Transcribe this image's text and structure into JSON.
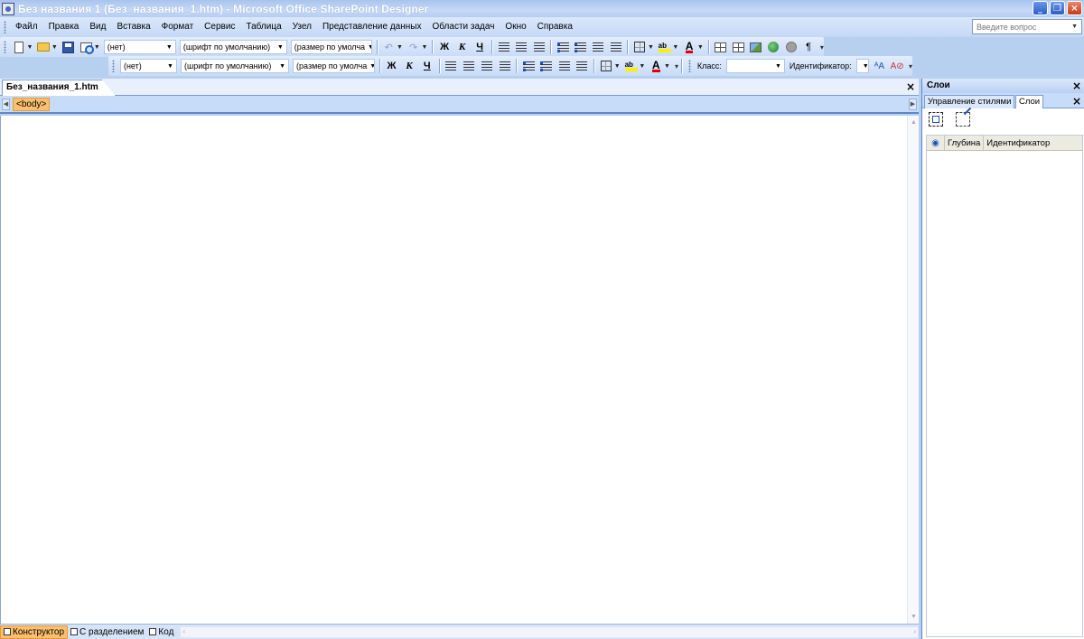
{
  "window": {
    "title": "Без названия 1 (Без_названия_1.htm) - Microsoft Office SharePoint Designer",
    "minimize": "_",
    "restore": "❐",
    "close": "×"
  },
  "menu": {
    "items": [
      "Файл",
      "Правка",
      "Вид",
      "Вставка",
      "Формат",
      "Сервис",
      "Таблица",
      "Узел",
      "Представление данных",
      "Области задач",
      "Окно",
      "Справка"
    ],
    "help_placeholder": "Введите вопрос"
  },
  "toolbar1": {
    "style_combo": "(нет)",
    "font_combo": "(шрифт по умолчанию)",
    "size_combo": "(размер по умолча",
    "bold": "Ж",
    "italic": "К",
    "underline": "Ч"
  },
  "toolbar2": {
    "style_combo": "(нет)",
    "font_combo": "(шрифт по умолчанию)",
    "size_combo": "(размер по умолча",
    "bold": "Ж",
    "italic": "К",
    "underline": "Ч",
    "class_label": "Класс:",
    "class_value": "",
    "id_label": "Идентификатор:",
    "id_value": ""
  },
  "document": {
    "tab_label": "Без_названия_1.htm",
    "tag_selector": "<body>"
  },
  "viewbar": {
    "design": "Конструктор",
    "split": "С разделением",
    "code": "Код"
  },
  "pane": {
    "title": "Слои",
    "tabs": [
      "Управление стилями",
      "Слои"
    ],
    "columns": [
      "Глубина",
      "Идентификатор"
    ]
  },
  "colors": {
    "accent": "#fbbf6e",
    "frame": "#b8d0f0"
  }
}
